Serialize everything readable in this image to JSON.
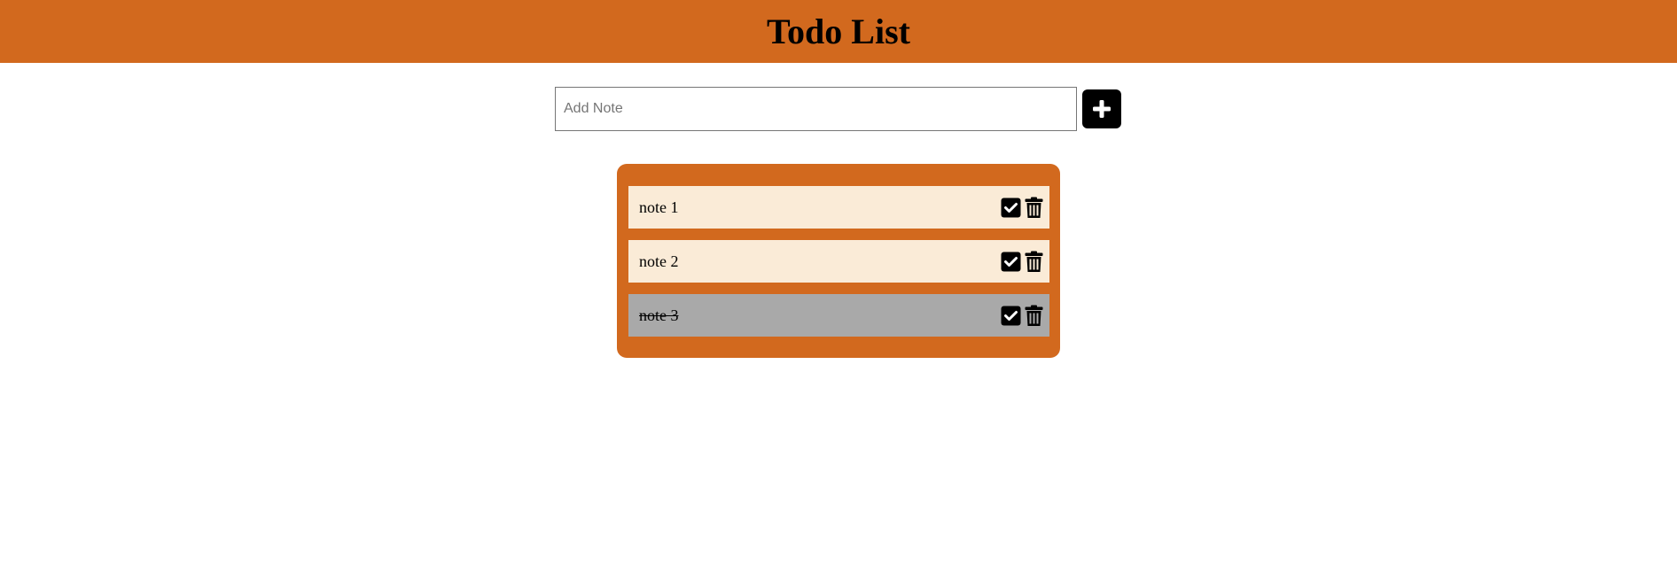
{
  "header": {
    "title": "Todo List"
  },
  "add_note": {
    "placeholder": "Add Note",
    "value": "",
    "button_icon": "plus-icon"
  },
  "notes": [
    {
      "text": "note 1",
      "completed": false
    },
    {
      "text": "note 2",
      "completed": false
    },
    {
      "text": "note 3",
      "completed": true
    }
  ],
  "colors": {
    "accent": "#d2691e",
    "note_bg": "#faebd7",
    "note_done_bg": "#a9a9a9"
  },
  "icons": {
    "complete": "check-square-icon",
    "delete": "trash-icon"
  }
}
